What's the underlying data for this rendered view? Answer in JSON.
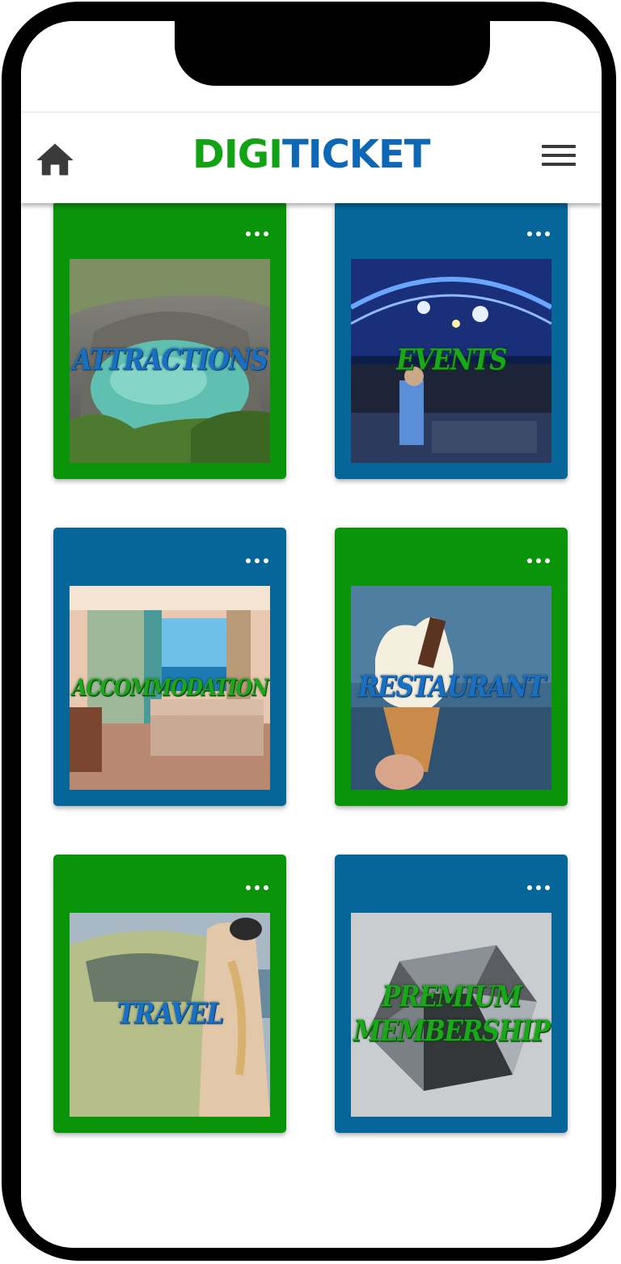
{
  "header": {
    "logo_part1": "DIGI",
    "logo_part2": "TICKET",
    "home_icon": "home-icon",
    "menu_icon": "hamburger-menu-icon"
  },
  "colors": {
    "brand_green": "#0a940a",
    "brand_blue": "#066699"
  },
  "cards": [
    {
      "label": "ATTRACTIONS",
      "bg": "green",
      "label_color": "blue",
      "image": "canyon-lake-photo"
    },
    {
      "label": "EVENTS",
      "bg": "blue",
      "label_color": "green",
      "image": "concert-dj-photo"
    },
    {
      "label": "ACCOMMODATION",
      "bg": "blue",
      "label_color": "green",
      "image": "hotel-room-photo"
    },
    {
      "label": "RESTAURANT",
      "bg": "green",
      "label_color": "blue",
      "image": "ice-cream-photo"
    },
    {
      "label": "TRAVEL",
      "bg": "green",
      "label_color": "blue",
      "image": "vintage-car-photo"
    },
    {
      "label": "PREMIUM MEMBERSHIP",
      "bg": "blue",
      "label_color": "green",
      "image": "diamond-photo"
    }
  ]
}
